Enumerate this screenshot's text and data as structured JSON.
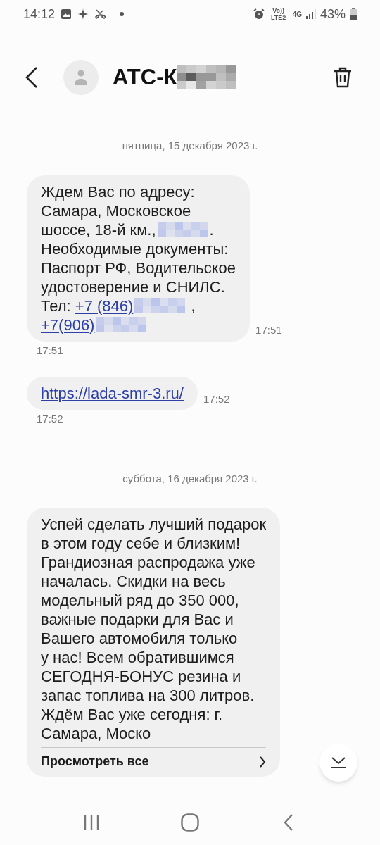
{
  "status_bar": {
    "time": "14:12",
    "network": "Vo)) LTE2",
    "data": "4G",
    "battery": "43%"
  },
  "header": {
    "title": "АТС-К"
  },
  "messages": [
    {
      "kind": "date",
      "text": "пятница, 15 декабря 2023 г."
    },
    {
      "kind": "bubble",
      "time_side": "17:51",
      "time_below": "17:51",
      "lines": [
        [
          {
            "kind": "text",
            "text": "Ждем Вас по адресу:"
          }
        ],
        [
          {
            "kind": "text",
            "text": "Самара, Московское"
          }
        ],
        [
          {
            "kind": "text",
            "text": "шоссе, 18-й км.,"
          },
          {
            "kind": "redacted"
          },
          {
            "kind": "text",
            "text": "."
          }
        ],
        [
          {
            "kind": "text",
            "text": "Необходимые документы:"
          }
        ],
        [
          {
            "kind": "text",
            "text": "Паспорт РФ, Водительское"
          }
        ],
        [
          {
            "kind": "text",
            "text": "удостоверение и СНИЛС."
          }
        ],
        [
          {
            "kind": "text",
            "text": "Тел: "
          },
          {
            "kind": "link",
            "text": "+7 (846)"
          },
          {
            "kind": "redacted"
          },
          {
            "kind": "text",
            "text": " ,"
          }
        ],
        [
          {
            "kind": "link",
            "text": "+7(906)"
          },
          {
            "kind": "redacted"
          }
        ]
      ]
    },
    {
      "kind": "bubble",
      "time_side": "17:52",
      "time_below": "17:52",
      "lines": [
        [
          {
            "kind": "link",
            "text": "https://lada-smr-3.ru/"
          }
        ]
      ]
    },
    {
      "kind": "date",
      "text": "суббота, 16 декабря 2023 г."
    },
    {
      "kind": "bubble",
      "footer": "Просмотреть все",
      "lines": [
        [
          {
            "kind": "text",
            "text": "Успей сделать лучший подарок"
          }
        ],
        [
          {
            "kind": "text",
            "text": "в этом году себе и близким!"
          }
        ],
        [
          {
            "kind": "text",
            "text": "Грандиозная распродажа уже"
          }
        ],
        [
          {
            "kind": "text",
            "text": "началась. Скидки на весь"
          }
        ],
        [
          {
            "kind": "text",
            "text": "модельный ряд до 350 000,"
          }
        ],
        [
          {
            "kind": "text",
            "text": "важные подарки для Вас и"
          }
        ],
        [
          {
            "kind": "text",
            "text": "Вашего автомобиля только"
          }
        ],
        [
          {
            "kind": "text",
            "text": "у нас! Всем обратившимся"
          }
        ],
        [
          {
            "kind": "text",
            "text": "СЕГОДНЯ-БОНУС резина и"
          }
        ],
        [
          {
            "kind": "text",
            "text": "запас топлива на 300 литров."
          }
        ],
        [
          {
            "kind": "text",
            "text": "Ждём Вас уже сегодня: г."
          }
        ],
        [
          {
            "kind": "text",
            "text": "Самара, Моско"
          }
        ]
      ]
    }
  ]
}
